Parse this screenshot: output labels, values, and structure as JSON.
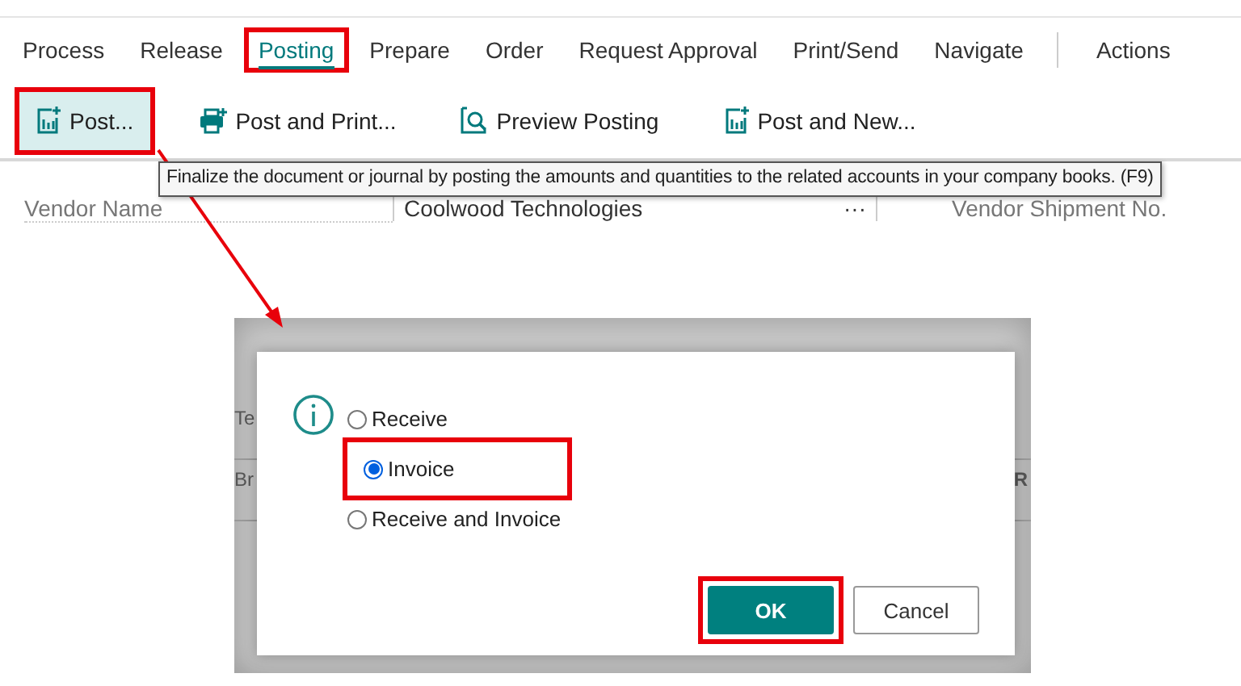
{
  "tabs": [
    {
      "label": "Process",
      "selected": false,
      "highlighted": false
    },
    {
      "label": "Release",
      "selected": false,
      "highlighted": false
    },
    {
      "label": "Posting",
      "selected": true,
      "highlighted": true
    },
    {
      "label": "Prepare",
      "selected": false,
      "highlighted": false
    },
    {
      "label": "Order",
      "selected": false,
      "highlighted": false
    },
    {
      "label": "Request Approval",
      "selected": false,
      "highlighted": false
    },
    {
      "label": "Print/Send",
      "selected": false,
      "highlighted": false
    },
    {
      "label": "Navigate",
      "selected": false,
      "highlighted": false
    }
  ],
  "actions_tab": {
    "label": "Actions"
  },
  "action_buttons": [
    {
      "label": "Post...",
      "kind": "post",
      "selected": true,
      "highlighted": true
    },
    {
      "label": "Post and Print...",
      "kind": "print",
      "selected": false,
      "highlighted": false
    },
    {
      "label": "Preview Posting",
      "kind": "preview",
      "selected": false,
      "highlighted": false
    },
    {
      "label": "Post and New...",
      "kind": "post",
      "selected": false,
      "highlighted": false
    }
  ],
  "tooltip": "Finalize the document or journal by posting the amounts and quantities to the related accounts in your company books. (F9)",
  "vendor_row": {
    "label": "Vendor Name",
    "value": "Coolwood Technologies",
    "more": "···",
    "next_label": "Vendor Shipment No."
  },
  "backdrop_fragments": [
    "Te",
    "Br",
    "R"
  ],
  "dialog": {
    "options": [
      {
        "label": "Receive",
        "selected": false,
        "highlighted": false
      },
      {
        "label": "Invoice",
        "selected": true,
        "highlighted": true
      },
      {
        "label": "Receive and Invoice",
        "selected": false,
        "highlighted": false
      }
    ],
    "buttons": [
      {
        "label": "OK",
        "kind": "primary",
        "highlighted": true
      },
      {
        "label": "Cancel",
        "kind": "secondary",
        "highlighted": false
      }
    ]
  },
  "arrow": true
}
